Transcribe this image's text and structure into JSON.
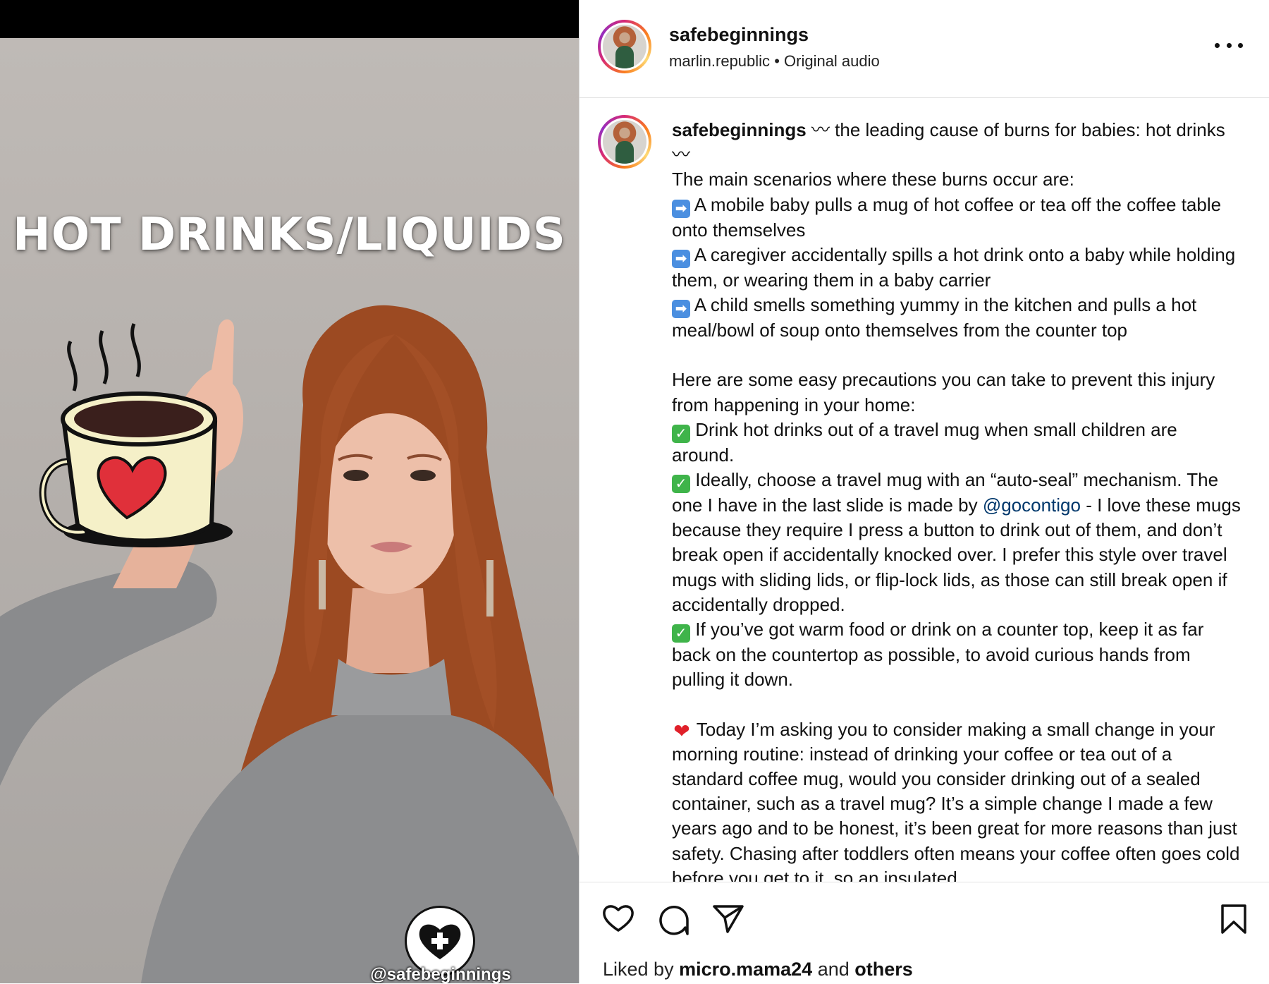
{
  "media": {
    "overlay_title": "HOT DRINKS/LIQUIDS",
    "watermark_handle": "@safebeginnings",
    "mug_heart_color": "#e0303a"
  },
  "header": {
    "username": "safebeginnings",
    "audio_author": "marlin.republic",
    "separator": "•",
    "audio_label": "Original audio",
    "more_icon": "more-horizontal-icon"
  },
  "caption": {
    "username": "safebeginnings",
    "intro": " 〰 the leading cause of burns for babies: hot drinks 〰",
    "scenarios_title": "The main scenarios where these burns occur are:",
    "scenarios": [
      "A mobile baby pulls a mug of hot coffee or tea off the coffee table onto themselves",
      "A caregiver accidentally spills a hot drink onto a baby while holding them, or wearing them in a baby carrier",
      "A child smells something yummy in the kitchen and pulls a hot meal/bowl of soup onto themselves from the counter top"
    ],
    "precautions_title": "Here are some easy precautions you can take to prevent this injury from happening in your home:",
    "precaution_1": "Drink hot drinks out of a travel mug when small children are around.",
    "precaution_2_before": "Ideally, choose a travel mug with an “auto-seal” mechanism. The one I have in the last slide is made by ",
    "precaution_2_mention": "@gocontigo",
    "precaution_2_after": " - I love these mugs because they require I press a button to drink out of them, and don’t break open if accidentally knocked over. I prefer this style over travel mugs with sliding lids, or flip-lock lids, as those can still break open if accidentally dropped.",
    "precaution_3": "If you’ve got warm food or drink on a counter top, keep it as far back on the countertop as possible, to avoid curious hands from pulling it down.",
    "ask": "Today I’m asking you to consider making a small change in your morning routine: instead of drinking your coffee or tea out of a standard coffee mug, would you consider drinking out of a sealed container, such as a travel mug? It’s a simple change I made a few years ago and to be honest, it’s been great for more reasons than just safety. Chasing after toddlers often means your coffee often goes cold before you get to it, so an insulated",
    "arrow_emoji": "➡",
    "check_emoji": "✓",
    "heart_emoji": "❤"
  },
  "actions": {
    "like_icon": "heart-outline-icon",
    "comment_icon": "comment-icon",
    "share_icon": "send-icon",
    "save_icon": "bookmark-icon",
    "liked_prefix": "Liked by ",
    "liked_user": "micro.mama24",
    "liked_mid": " and ",
    "liked_others": "others"
  },
  "colors": {
    "mention": "#00376b",
    "ring_start": "#d62976",
    "ring_end": "#feda75"
  }
}
